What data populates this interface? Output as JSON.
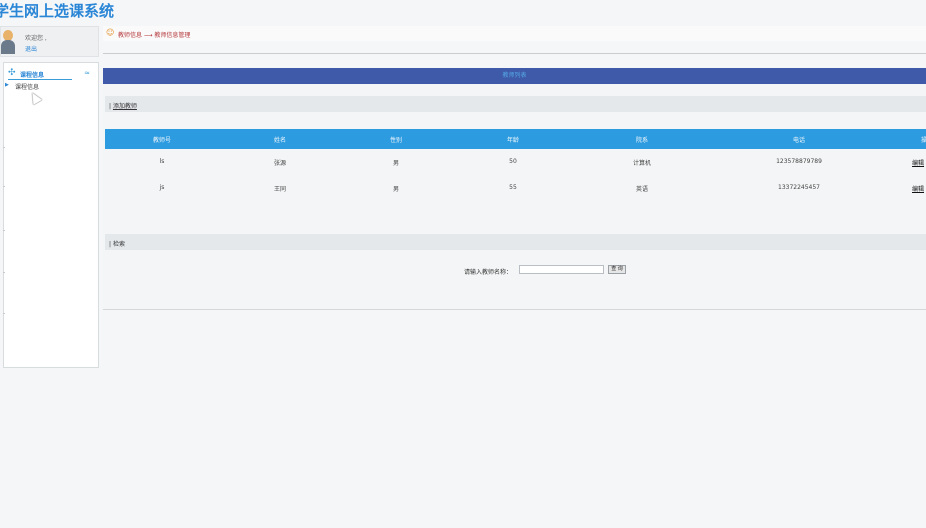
{
  "app_title": "学生网上选课系统",
  "user_panel": {
    "welcome": "欢迎您 ,",
    "logout": "退出"
  },
  "sidebar": {
    "menu_title": "课程信息",
    "items": [
      {
        "label": "课程信息"
      }
    ]
  },
  "breadcrumb": "教师信息 ⟶ 教师信息管理",
  "main": {
    "list_title": "教师列表",
    "add_label": "添加教师",
    "table": {
      "headers": [
        "教师号",
        "姓名",
        "性别",
        "年龄",
        "院系",
        "电话",
        "操"
      ],
      "rows": [
        {
          "cells": [
            "ls",
            "张源",
            "男",
            "50",
            "计算机",
            "123578879789"
          ],
          "op": "编辑"
        },
        {
          "cells": [
            "js",
            "王同",
            "男",
            "55",
            "英语",
            "13372245457"
          ],
          "op": "编辑"
        }
      ]
    },
    "search_section": "检索",
    "search_label": "请输入教师名称：",
    "search_value": "",
    "search_button": "查 询"
  },
  "colors": {
    "accent": "#2a86d6",
    "list_title_bg": "#3e5aa8",
    "table_header_bg": "#2d9be0",
    "breadcrumb_text": "#b5373a"
  }
}
